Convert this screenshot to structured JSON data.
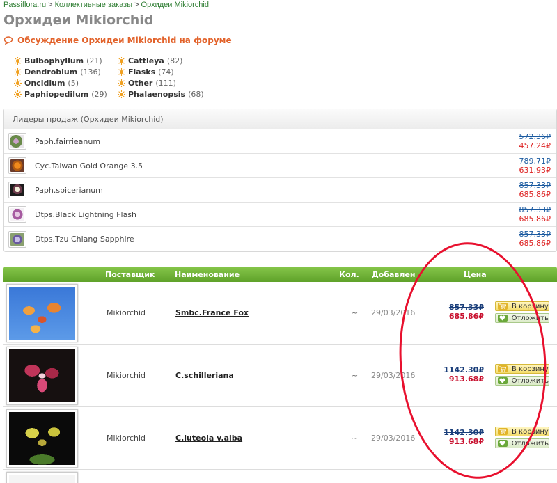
{
  "breadcrumb": {
    "items": [
      "Passiflora.ru",
      "Коллективные заказы",
      "Орхидеи Mikiorchid"
    ],
    "separator": ">"
  },
  "page_title": "Орхидеи Mikiorchid",
  "forum_link": "Обсуждение Орхидеи Mikiorchid на форуме",
  "categories": [
    {
      "name": "Bulbophyllum",
      "count": "(21)"
    },
    {
      "name": "Cattleya",
      "count": "(82)"
    },
    {
      "name": "Dendrobium",
      "count": "(136)"
    },
    {
      "name": "Flasks",
      "count": "(74)"
    },
    {
      "name": "Oncidium",
      "count": "(5)"
    },
    {
      "name": "Other",
      "count": "(111)"
    },
    {
      "name": "Paphiopedilum",
      "count": "(29)"
    },
    {
      "name": "Phalaenopsis",
      "count": "(68)"
    }
  ],
  "leaders": {
    "title": "Лидеры продаж (Орхидеи Mikiorchid)",
    "rows": [
      {
        "name": "Paph.fairrieanum",
        "old_price": "572.36₽",
        "new_price": "457.24₽"
      },
      {
        "name": "Cyc.Taiwan Gold Orange 3.5",
        "old_price": "789.71₽",
        "new_price": "631.93₽"
      },
      {
        "name": "Paph.spicerianum",
        "old_price": "857.33₽",
        "new_price": "685.86₽"
      },
      {
        "name": "Dtps.Black Lightning Flash",
        "old_price": "857.33₽",
        "new_price": "685.86₽"
      },
      {
        "name": "Dtps.Tzu Chiang Sapphire",
        "old_price": "857.33₽",
        "new_price": "685.86₽"
      }
    ]
  },
  "products": {
    "headers": {
      "supplier": "Поставщик",
      "name": "Наименование",
      "qty": "Кол.",
      "added": "Добавлен",
      "price": "Цена"
    },
    "rows": [
      {
        "supplier": "Mikiorchid",
        "name": "Smbc.France Fox",
        "qty": "~",
        "added": "29/03/2016",
        "old_price": "857.33₽",
        "new_price": "685.86₽",
        "cart_label": "В корзину",
        "later_label": "Отложить"
      },
      {
        "supplier": "Mikiorchid",
        "name": "C.schilleriana",
        "qty": "~",
        "added": "29/03/2016",
        "old_price": "1142.30₽",
        "new_price": "913.68₽",
        "cart_label": "В корзину",
        "later_label": "Отложить"
      },
      {
        "supplier": "Mikiorchid",
        "name": "C.luteola v.alba",
        "qty": "~",
        "added": "29/03/2016",
        "old_price": "1142.30₽",
        "new_price": "913.68₽",
        "cart_label": "В корзину",
        "later_label": "Отложить"
      }
    ]
  },
  "colors": {
    "accent_orange": "#e2622a",
    "header_green": "#6cb033",
    "old_price_blue": "#1a5aa0",
    "new_price_red": "#c8102e",
    "annotation_red": "#e8102e"
  }
}
